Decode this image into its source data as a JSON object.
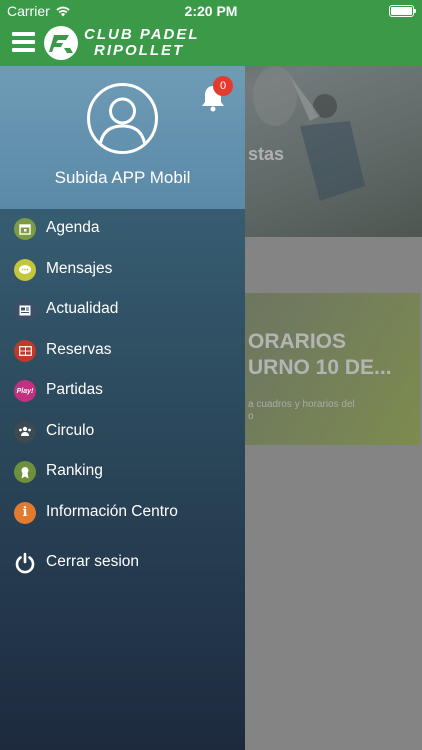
{
  "status_bar": {
    "carrier": "Carrier",
    "time": "2:20 PM"
  },
  "header": {
    "logo_line1": "CLUB PADEL",
    "logo_line2": "RIPOLLET"
  },
  "background": {
    "photo_text": "stas",
    "card_title_line1": "ORARIOS",
    "card_title_line2": "URNO 10 DE...",
    "card_sub_line1": "a cuadros y horarios del",
    "card_sub_line2": "o"
  },
  "profile": {
    "name": "Subida APP Mobil",
    "notifications": "0"
  },
  "menu": {
    "items": [
      {
        "label": "Agenda",
        "icon": "calendar-icon",
        "color": "#7d9b45"
      },
      {
        "label": "Mensajes",
        "icon": "chat-icon",
        "color": "#c3c53a"
      },
      {
        "label": "Actualidad",
        "icon": "news-icon",
        "color": "#3c4f66"
      },
      {
        "label": "Reservas",
        "icon": "court-icon",
        "color": "#c0392b"
      },
      {
        "label": "Partidas",
        "icon": "play-icon",
        "color": "#c0317e",
        "icon_text": "Play!"
      },
      {
        "label": "Circulo",
        "icon": "people-icon",
        "color": "#3d4a52"
      },
      {
        "label": "Ranking",
        "icon": "medal-icon",
        "color": "#6e8f3c"
      },
      {
        "label": "Información Centro",
        "icon": "info-icon",
        "color": "#e07b30"
      },
      {
        "label": "Cerrar sesion",
        "icon": "power-icon",
        "color": "#ffffff"
      }
    ]
  }
}
